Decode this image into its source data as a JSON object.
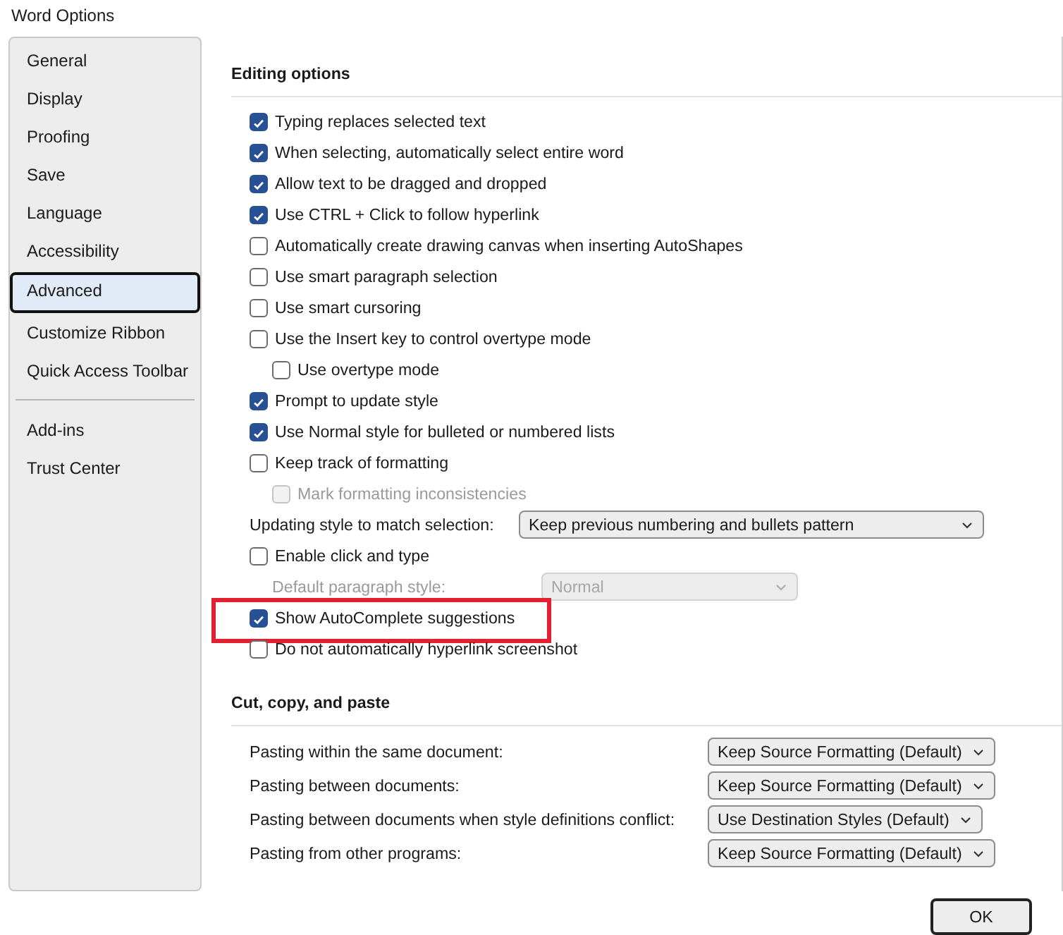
{
  "window": {
    "title": "Word Options"
  },
  "sidebar": {
    "groups": [
      [
        {
          "label": "General",
          "selected": false
        },
        {
          "label": "Display",
          "selected": false
        },
        {
          "label": "Proofing",
          "selected": false
        },
        {
          "label": "Save",
          "selected": false
        },
        {
          "label": "Language",
          "selected": false
        },
        {
          "label": "Accessibility",
          "selected": false
        },
        {
          "label": "Advanced",
          "selected": true
        },
        {
          "label": "Customize Ribbon",
          "selected": false
        },
        {
          "label": "Quick Access Toolbar",
          "selected": false
        }
      ],
      [
        {
          "label": "Add-ins",
          "selected": false
        },
        {
          "label": "Trust Center",
          "selected": false
        }
      ]
    ]
  },
  "sections": [
    {
      "title": "Editing options",
      "options": [
        {
          "kind": "checkbox",
          "label": "Typing replaces selected text",
          "checked": true
        },
        {
          "kind": "checkbox",
          "label": "When selecting, automatically select entire word",
          "checked": true
        },
        {
          "kind": "checkbox",
          "label": "Allow text to be dragged and dropped",
          "checked": true
        },
        {
          "kind": "checkbox",
          "label": "Use CTRL + Click to follow hyperlink",
          "checked": true
        },
        {
          "kind": "checkbox",
          "label": "Automatically create drawing canvas when inserting AutoShapes",
          "checked": false
        },
        {
          "kind": "checkbox",
          "label": "Use smart paragraph selection",
          "checked": false
        },
        {
          "kind": "checkbox",
          "label": "Use smart cursoring",
          "checked": false
        },
        {
          "kind": "checkbox",
          "label": "Use the Insert key to control overtype mode",
          "checked": false,
          "children": [
            {
              "kind": "checkbox",
              "label": "Use overtype mode",
              "checked": false
            }
          ]
        },
        {
          "kind": "checkbox",
          "label": "Prompt to update style",
          "checked": true
        },
        {
          "kind": "checkbox",
          "label": "Use Normal style for bulleted or numbered lists",
          "checked": true
        },
        {
          "kind": "checkbox",
          "label": "Keep track of formatting",
          "checked": false,
          "children": [
            {
              "kind": "checkbox",
              "label": "Mark formatting inconsistencies",
              "checked": false,
              "disabled": true
            }
          ]
        },
        {
          "kind": "dropdown",
          "label": "Updating style to match selection:",
          "value": "Keep previous numbering and bullets pattern",
          "disabled": false
        },
        {
          "kind": "checkbox",
          "label": "Enable click and type",
          "checked": false,
          "children": [
            {
              "kind": "dropdown",
              "label": "Default paragraph style:",
              "value": "Normal",
              "disabled": true
            }
          ]
        },
        {
          "kind": "checkbox",
          "label": "Show AutoComplete suggestions",
          "checked": true,
          "highlighted": true
        },
        {
          "kind": "checkbox",
          "label": "Do not automatically hyperlink screenshot",
          "checked": false
        }
      ]
    },
    {
      "title": "Cut, copy, and paste",
      "options": [
        {
          "kind": "dropdown",
          "label": "Pasting within the same document:",
          "value": "Keep Source Formatting (Default)",
          "disabled": false
        },
        {
          "kind": "dropdown",
          "label": "Pasting between documents:",
          "value": "Keep Source Formatting (Default)",
          "disabled": false
        },
        {
          "kind": "dropdown",
          "label": "Pasting between documents when style definitions conflict:",
          "value": "Use Destination Styles (Default)",
          "disabled": false
        },
        {
          "kind": "dropdown",
          "label": "Pasting from other programs:",
          "value": "Keep Source Formatting (Default)",
          "disabled": false
        }
      ]
    }
  ],
  "buttons": [
    {
      "label": "OK"
    }
  ]
}
